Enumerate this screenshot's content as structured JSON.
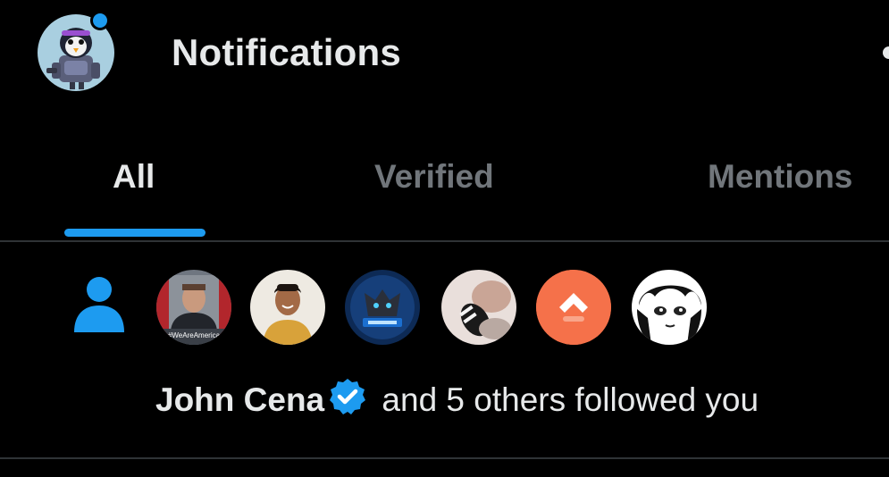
{
  "header": {
    "title": "Notifications",
    "profile_avatar_icon": "penguin-robot-avatar",
    "notification_dot_color": "#1d9bf0"
  },
  "tabs": [
    {
      "label": "All",
      "active": true
    },
    {
      "label": "Verified",
      "active": false
    },
    {
      "label": "Mentions",
      "active": false
    }
  ],
  "colors": {
    "accent": "#1d9bf0",
    "background": "#000000",
    "text_primary": "#e7e9ea",
    "text_secondary": "#71767b",
    "divider": "#2f3336"
  },
  "notification": {
    "type_icon": "person-follow-icon",
    "avatars": [
      {
        "name": "john-cena-avatar",
        "caption": "#WeAreAmerica"
      },
      {
        "name": "user-avatar-2"
      },
      {
        "name": "user-avatar-3"
      },
      {
        "name": "user-avatar-4"
      },
      {
        "name": "user-avatar-5"
      },
      {
        "name": "user-avatar-6"
      }
    ],
    "name": "John Cena",
    "verified": true,
    "rest": " and 5 others followed you"
  }
}
